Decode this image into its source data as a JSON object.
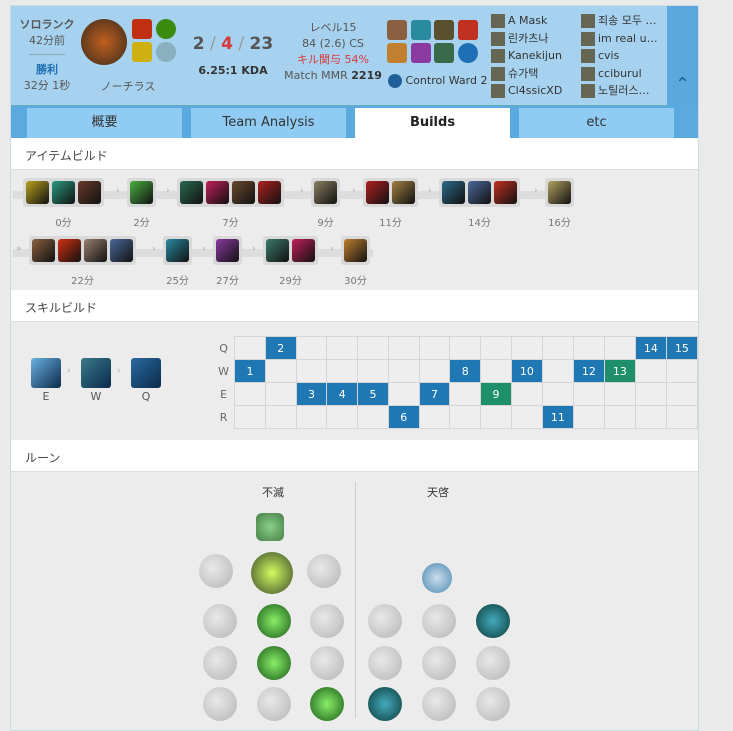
{
  "match": {
    "queue": "ソロランク",
    "ago": "42分前",
    "result": "勝利",
    "duration": "32分 1秒",
    "champion": "ノーチラス",
    "kda": {
      "k": "2",
      "d": "4",
      "a": "23",
      "ratio": "6.25:1 KDA"
    },
    "level": "レベル15",
    "cs": "84 (2.6) CS",
    "kill_participation": "キル関与 54%",
    "mmr_label": "Match MMR",
    "mmr": "2219",
    "ward": "Control Ward 2",
    "team1": [
      "A Mask",
      "린카츠나",
      "Kanekijun",
      "슈가택",
      "Cl4ssicXD"
    ],
    "team2": [
      "죄송 모두 …",
      "im real u…",
      "cvis",
      "cciburul",
      "노틸러스…"
    ]
  },
  "tabs": [
    "概要",
    "Team Analysis",
    "Builds",
    "etc"
  ],
  "sections": {
    "items": "アイテムビルド",
    "skills": "スキルビルド",
    "runes": "ルーン"
  },
  "item_groups": [
    {
      "time": "0分",
      "colors": [
        "#b8a020",
        "#2a9a80",
        "#6a3a2a"
      ]
    },
    {
      "time": "2分",
      "colors": [
        "#4ab040"
      ]
    },
    {
      "time": "7分",
      "colors": [
        "#2a6a50",
        "#c0205a",
        "#6a4a30",
        "#b02020"
      ]
    },
    {
      "time": "9分",
      "colors": [
        "#8a8060"
      ]
    },
    {
      "time": "11分",
      "colors": [
        "#b02020",
        "#a08040"
      ]
    },
    {
      "time": "14分",
      "colors": [
        "#2a6a8a",
        "#4a6a9a",
        "#c03020"
      ]
    },
    {
      "time": "16分",
      "colors": [
        "#b0a060"
      ]
    },
    {
      "time": "22分",
      "colors": [
        "#8a6040",
        "#d03010",
        "#9a8070",
        "#4a6a9a"
      ]
    },
    {
      "time": "25分",
      "colors": [
        "#2a8aa0"
      ]
    },
    {
      "time": "27分",
      "colors": [
        "#8a3aa0"
      ]
    },
    {
      "time": "29分",
      "colors": [
        "#3a7a6a",
        "#c0205a"
      ]
    },
    {
      "time": "30分",
      "colors": [
        "#c08030"
      ]
    }
  ],
  "skill_order": {
    "labels": [
      "E",
      "W",
      "Q"
    ],
    "rows": [
      "Q",
      "W",
      "E",
      "R"
    ],
    "levels": [
      "W",
      "Q",
      "E",
      "E",
      "E",
      "R",
      "E",
      "W",
      "E",
      "W",
      "R",
      "W",
      "W",
      "Q",
      "Q"
    ],
    "highlight": [
      9,
      13
    ]
  },
  "runes": {
    "primary": "不滅",
    "secondary": "天啓"
  },
  "colors": {
    "header": "#a6d2f0",
    "accent": "#1f78b4",
    "green": "#1e8f6a",
    "death": "#d9383a"
  }
}
